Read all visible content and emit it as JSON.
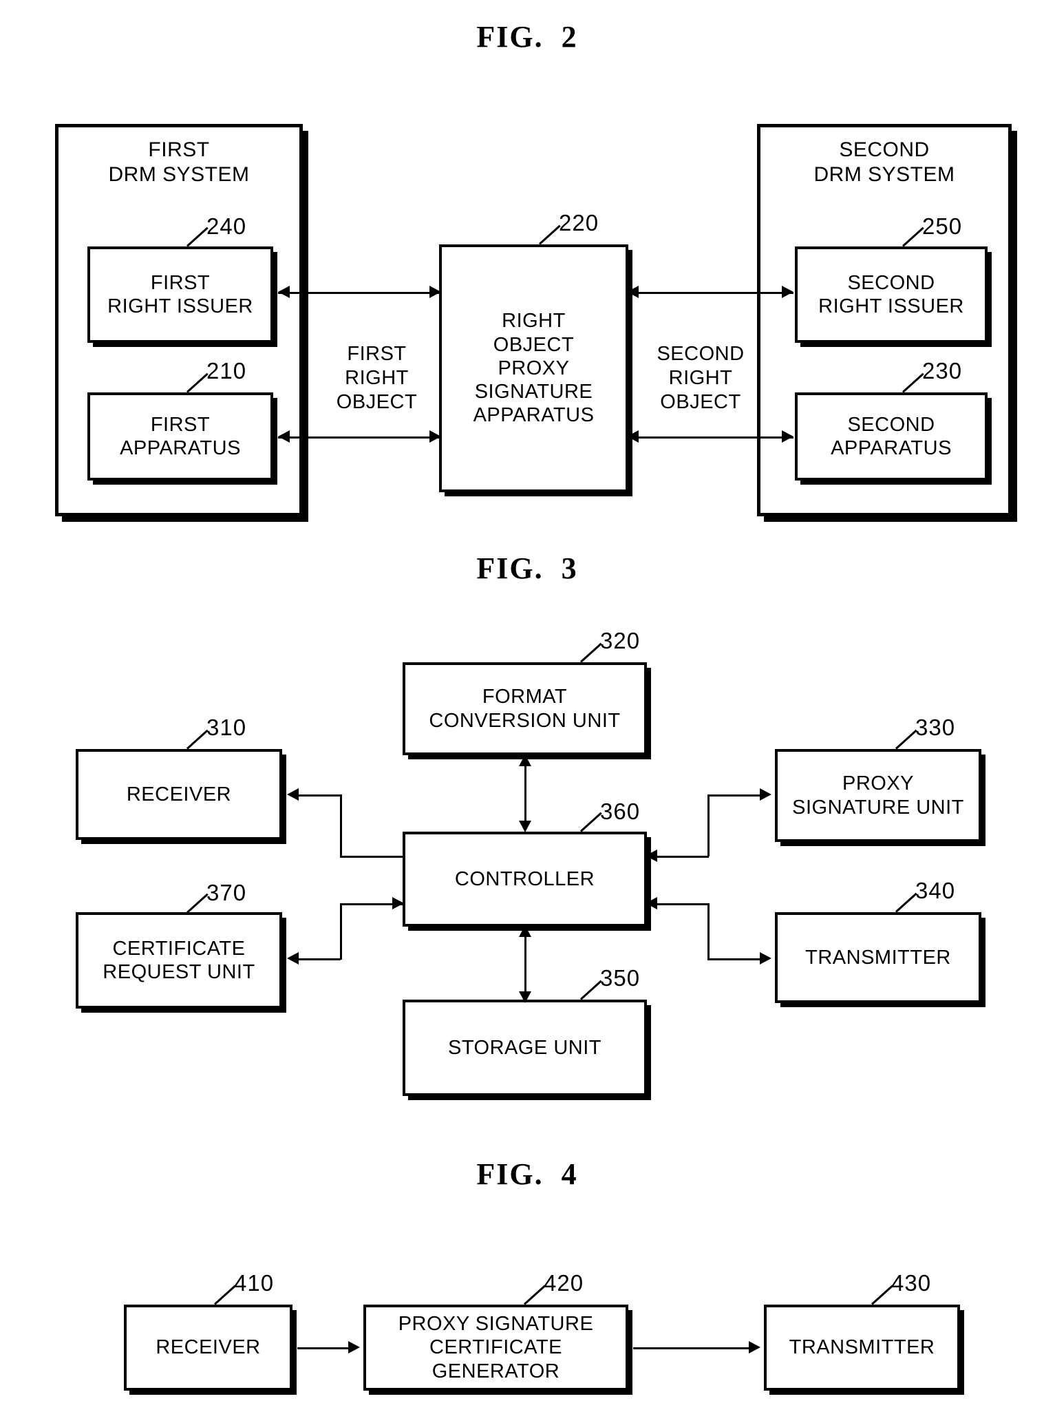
{
  "figures": [
    {
      "title": "FIG.  2",
      "containers": [
        {
          "id": "first-drm-system",
          "label": "FIRST\nDRM SYSTEM"
        },
        {
          "id": "second-drm-system",
          "label": "SECOND\nDRM SYSTEM"
        }
      ],
      "boxes": [
        {
          "id": "first-right-issuer",
          "label": "FIRST\nRIGHT ISSUER",
          "ref": "240"
        },
        {
          "id": "first-apparatus",
          "label": "FIRST\nAPPARATUS",
          "ref": "210"
        },
        {
          "id": "right-object-proxy-signature-apparatus",
          "label": "RIGHT\nOBJECT\nPROXY\nSIGNATURE\nAPPARATUS",
          "ref": "220"
        },
        {
          "id": "second-right-issuer",
          "label": "SECOND\nRIGHT ISSUER",
          "ref": "250"
        },
        {
          "id": "second-apparatus",
          "label": "SECOND\nAPPARATUS",
          "ref": "230"
        }
      ],
      "edge_labels": [
        {
          "id": "first-right-object",
          "label": "FIRST\nRIGHT\nOBJECT"
        },
        {
          "id": "second-right-object",
          "label": "SECOND\nRIGHT\nOBJECT"
        }
      ]
    },
    {
      "title": "FIG.  3",
      "boxes": [
        {
          "id": "format-conversion-unit",
          "label": "FORMAT\nCONVERSION UNIT",
          "ref": "320"
        },
        {
          "id": "receiver",
          "label": "RECEIVER",
          "ref": "310"
        },
        {
          "id": "proxy-signature-unit",
          "label": "PROXY\nSIGNATURE UNIT",
          "ref": "330"
        },
        {
          "id": "controller",
          "label": "CONTROLLER",
          "ref": "360"
        },
        {
          "id": "certificate-request-unit",
          "label": "CERTIFICATE\nREQUEST UNIT",
          "ref": "370"
        },
        {
          "id": "transmitter",
          "label": "TRANSMITTER",
          "ref": "340"
        },
        {
          "id": "storage-unit",
          "label": "STORAGE UNIT",
          "ref": "350"
        }
      ]
    },
    {
      "title": "FIG.  4",
      "boxes": [
        {
          "id": "receiver",
          "label": "RECEIVER",
          "ref": "410"
        },
        {
          "id": "proxy-signature-certificate-generator",
          "label": "PROXY SIGNATURE\nCERTIFICATE GENERATOR",
          "ref": "420"
        },
        {
          "id": "transmitter",
          "label": "TRANSMITTER",
          "ref": "430"
        }
      ]
    }
  ],
  "colors": {
    "ink": "#000000",
    "paper": "#ffffff"
  }
}
